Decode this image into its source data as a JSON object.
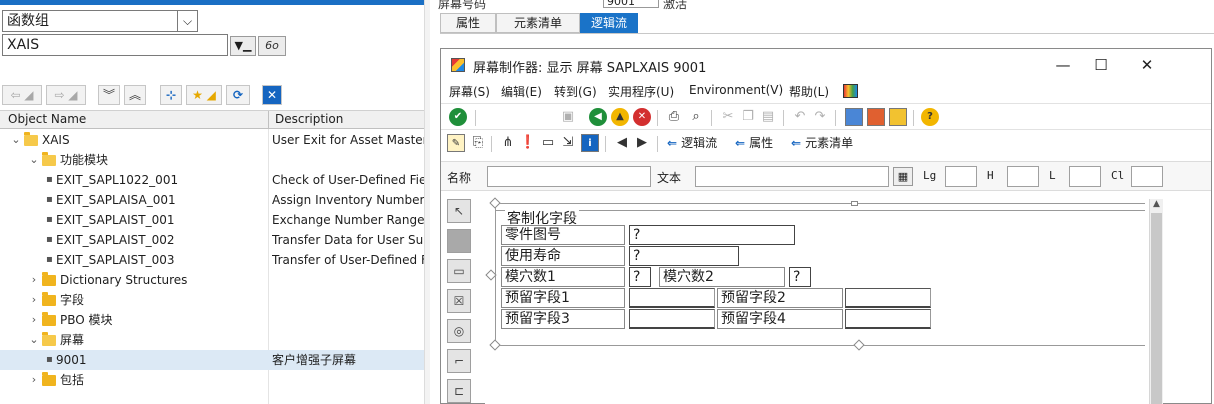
{
  "left": {
    "object_type": "函数组",
    "object_name": "XAIS",
    "columns": {
      "name": "Object Name",
      "description": "Description"
    },
    "tree": [
      {
        "label": "XAIS",
        "desc": "User Exit for Asset Master D",
        "level": 0,
        "kind": "folder",
        "expanded": true
      },
      {
        "label": "功能模块",
        "desc": "",
        "level": 1,
        "kind": "folder",
        "expanded": true
      },
      {
        "label": "EXIT_SAPL1022_001",
        "desc": "Check of User-Defined Fields",
        "level": 2,
        "kind": "leaf"
      },
      {
        "label": "EXIT_SAPLAISA_001",
        "desc": "Assign Inventory Number",
        "level": 2,
        "kind": "leaf"
      },
      {
        "label": "EXIT_SAPLAIST_001",
        "desc": "Exchange Number Range",
        "level": 2,
        "kind": "leaf"
      },
      {
        "label": "EXIT_SAPLAIST_002",
        "desc": "Transfer Data for User Subs",
        "level": 2,
        "kind": "leaf"
      },
      {
        "label": "EXIT_SAPLAIST_003",
        "desc": "Transfer of User-Defined Fie",
        "level": 2,
        "kind": "leaf"
      },
      {
        "label": "Dictionary Structures",
        "desc": "",
        "level": 1,
        "kind": "folder",
        "expanded": false
      },
      {
        "label": "字段",
        "desc": "",
        "level": 1,
        "kind": "folder",
        "expanded": false
      },
      {
        "label": "PBO 模块",
        "desc": "",
        "level": 1,
        "kind": "folder",
        "expanded": false
      },
      {
        "label": "屏幕",
        "desc": "",
        "level": 1,
        "kind": "folder",
        "expanded": true
      },
      {
        "label": "9001",
        "desc": "客户增强子屏幕",
        "level": 2,
        "kind": "leaf",
        "selected": true
      },
      {
        "label": "包括",
        "desc": "",
        "level": 1,
        "kind": "folder",
        "expanded": false
      }
    ]
  },
  "right": {
    "header_label": "屏幕号码",
    "screen_number": "9001",
    "header_after": "激活",
    "tabs": [
      {
        "label": "属性",
        "active": false
      },
      {
        "label": "元素清单",
        "active": false
      },
      {
        "label": "逻辑流",
        "active": true
      }
    ],
    "window": {
      "title": "屏幕制作器:  显示 屏幕 SAPLXAIS 9001",
      "controls": {
        "minimize": "—",
        "maximize": "☐",
        "close": "✕"
      },
      "menus": [
        "屏幕(S)",
        "编辑(E)",
        "转到(G)",
        "实用程序(U)",
        "Environment(V)",
        "帮助(L)"
      ],
      "toolbar2_links": {
        "flow": "逻辑流",
        "attributes": "属性",
        "elements": "元素清单"
      },
      "name_bar": {
        "name": "名称",
        "text": "文本",
        "lg": "Lg",
        "h": "H",
        "l": "L",
        "cl": "Cl"
      },
      "frame_title": "客制化字段",
      "fields": [
        {
          "label": "零件图号",
          "value": "?"
        },
        {
          "label": "使用寿命",
          "value": "?"
        },
        {
          "label": "模穴数1",
          "value": "?"
        },
        {
          "label": "模穴数2",
          "value": "?"
        },
        {
          "label": "预留字段1",
          "value": ""
        },
        {
          "label": "预留字段2",
          "value": ""
        },
        {
          "label": "预留字段3",
          "value": ""
        },
        {
          "label": "预留字段4",
          "value": ""
        }
      ]
    }
  }
}
